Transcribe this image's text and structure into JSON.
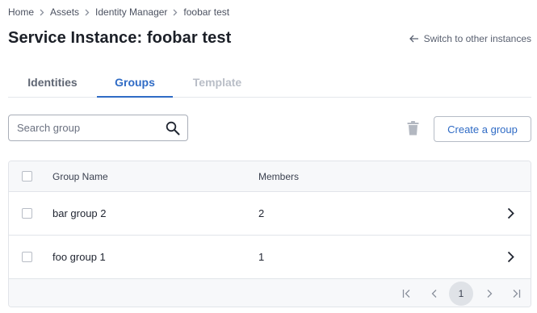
{
  "breadcrumb": [
    "Home",
    "Assets",
    "Identity Manager",
    "foobar test"
  ],
  "page_title": "Service Instance: foobar test",
  "switch_link": "Switch to other instances",
  "tabs": [
    {
      "label": "Identities",
      "state": "normal"
    },
    {
      "label": "Groups",
      "state": "active"
    },
    {
      "label": "Template",
      "state": "disabled"
    }
  ],
  "search": {
    "placeholder": "Search group",
    "value": ""
  },
  "actions": {
    "create_label": "Create a group",
    "delete_icon": "trash-icon"
  },
  "table": {
    "columns": [
      "Group Name",
      "Members"
    ],
    "rows": [
      {
        "name": "bar group 2",
        "members": "2"
      },
      {
        "name": "foo group 1",
        "members": "1"
      }
    ]
  },
  "pagination": {
    "current_page": "1"
  },
  "colors": {
    "accent": "#2f6bc5",
    "disabled": "#b9bec7",
    "border": "#e1e4e9"
  }
}
